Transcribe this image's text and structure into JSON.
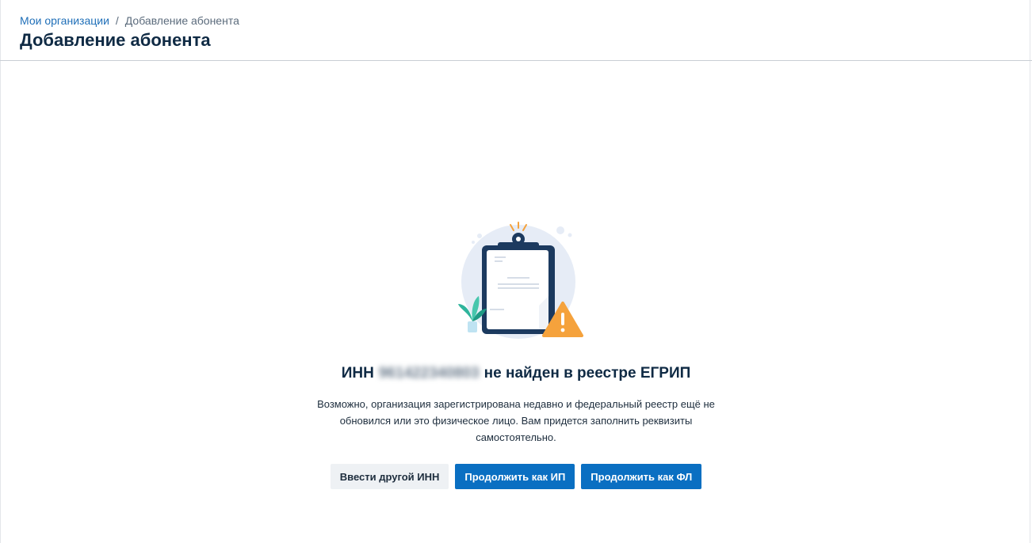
{
  "breadcrumb": {
    "parent": "Мои организации",
    "separator": "/",
    "current": "Добавление абонента"
  },
  "page": {
    "title": "Добавление абонента"
  },
  "result": {
    "prefix": "ИНН",
    "inn": "961422340803",
    "suffix": "не найден в реестре ЕГРИП",
    "description": "Возможно, организация зарегистрирована недавно и федеральный реестр ещё не обновился или это физическое лицо. Вам придется заполнить реквизиты самостоятельно."
  },
  "actions": {
    "other_inn": "Ввести другой ИНН",
    "continue_ip": "Продолжить как ИП",
    "continue_fl": "Продолжить как ФЛ"
  },
  "illustration": {
    "icons": [
      "clipboard-icon",
      "plant-icon",
      "warning-triangle-icon"
    ]
  },
  "colors": {
    "primary": "#0a6fc2",
    "title": "#0f2a44",
    "link": "#1f6fb8",
    "warning": "#f5a23c",
    "secondary_bg": "#eef1f4"
  }
}
